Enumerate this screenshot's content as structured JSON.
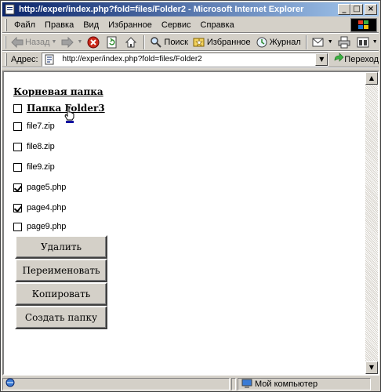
{
  "window": {
    "title": "http://exper/index.php?fold=files/Folder2 - Microsoft Internet Explorer"
  },
  "menu": [
    "Файл",
    "Правка",
    "Вид",
    "Избранное",
    "Сервис",
    "Справка"
  ],
  "toolbar": {
    "back": "Назад",
    "search": "Поиск",
    "favorites": "Избранное",
    "journal": "Журнал"
  },
  "address": {
    "label": "Адрес:",
    "value": "http://exper/index.php?fold=files/Folder2",
    "go": "Переход"
  },
  "page": {
    "root_link": "Корневая папка",
    "folder": {
      "name": "Папка Folder3",
      "checked": false
    },
    "files": [
      {
        "name": "file7.zip",
        "checked": false
      },
      {
        "name": "file8.zip",
        "checked": false
      },
      {
        "name": "file9.zip",
        "checked": false
      },
      {
        "name": "page5.php",
        "checked": true
      },
      {
        "name": "page4.php",
        "checked": true
      },
      {
        "name": "page9.php",
        "checked": false
      }
    ],
    "buttons": {
      "delete": "Удалить",
      "rename": "Переименовать",
      "copy": "Копировать",
      "create_folder": "Создать папку"
    }
  },
  "status": {
    "zone": "Мой компьютер"
  }
}
